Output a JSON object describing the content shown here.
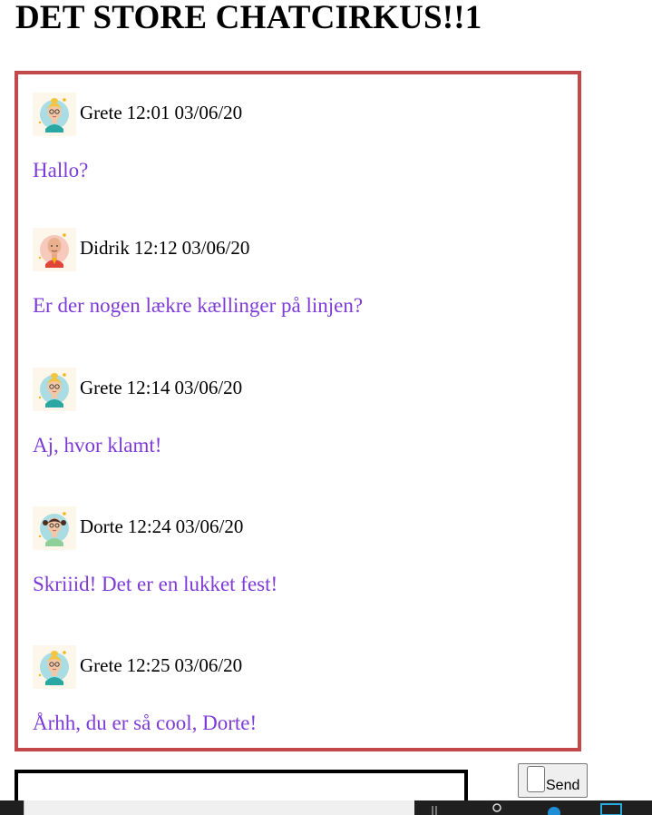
{
  "page": {
    "title": "DET STORE CHATCIRKUS!!1"
  },
  "messages": [
    {
      "user": "Grete",
      "time": "12:01",
      "date": "03/06/20",
      "text": "Hallo?",
      "avatar": "woman-glasses-avatar-icon"
    },
    {
      "user": "Didrik",
      "time": "12:12",
      "date": "03/06/20",
      "text": "Er der nogen lækre kællinger på linjen?",
      "avatar": "bald-man-avatar-icon"
    },
    {
      "user": "Grete",
      "time": "12:14",
      "date": "03/06/20",
      "text": "Aj, hvor klamt!",
      "avatar": "woman-glasses-avatar-icon"
    },
    {
      "user": "Dorte",
      "time": "12:24",
      "date": "03/06/20",
      "text": "Skriiid! Det er en lukket fest!",
      "avatar": "girl-pigtails-avatar-icon"
    },
    {
      "user": "Grete",
      "time": "12:25",
      "date": "03/06/20",
      "text": "Århh, du er så cool, Dorte!",
      "avatar": "woman-glasses-avatar-icon"
    }
  ],
  "composer": {
    "input_value": "",
    "send_label": "Send"
  },
  "colors": {
    "chat_border": "#c2484a",
    "message_text": "#7d3ad6"
  }
}
